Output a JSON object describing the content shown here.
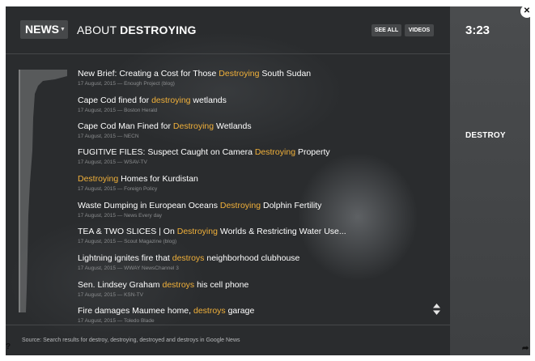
{
  "header": {
    "news_label": "NEWS",
    "title_prefix": "ABOUT",
    "title_term": "DESTROYING",
    "see_all_label": "SEE ALL",
    "videos_label": "VIDEOS"
  },
  "side": {
    "time": "3:23",
    "current_word": "DESTROY"
  },
  "colors": {
    "highlight": "#f0b03a",
    "background": "#2a2c2e"
  },
  "icons": {
    "news_menu": "caret-down-icon",
    "scroll": "up-down-arrows-icon",
    "close": "close-icon",
    "help": "question-icon",
    "share": "share-arrow-icon"
  },
  "items": [
    {
      "before": "New Brief: Creating a Cost for Those ",
      "highlight": "Destroying",
      "after": " South Sudan",
      "meta": "17 August, 2015 — Enough Project (blog)"
    },
    {
      "before": "Cape Cod fined for ",
      "highlight": "destroying",
      "after": " wetlands",
      "meta": "17 August, 2015 — Boston Herald"
    },
    {
      "before": "Cape Cod Man Fined for ",
      "highlight": "Destroying",
      "after": " Wetlands",
      "meta": "17 August, 2015 — NECN"
    },
    {
      "before": "FUGITIVE FILES: Suspect Caught on Camera ",
      "highlight": "Destroying",
      "after": " Property",
      "meta": "17 August, 2015 — WSAV-TV"
    },
    {
      "before": "",
      "highlight": "Destroying",
      "after": " Homes for Kurdistan",
      "meta": "17 August, 2015 — Foreign Policy"
    },
    {
      "before": "Waste Dumping in European Oceans ",
      "highlight": "Destroying",
      "after": " Dolphin Fertility",
      "meta": "17 August, 2015 — News Every day"
    },
    {
      "before": "TEA & TWO SLICES | On ",
      "highlight": "Destroying",
      "after": " Worlds & Restricting Water Use...",
      "meta": "17 August, 2015 — Scout Magazine (blog)"
    },
    {
      "before": "Lightning ignites fire that ",
      "highlight": "destroys",
      "after": " neighborhood clubhouse",
      "meta": "17 August, 2015 — WWAY NewsChannel 3"
    },
    {
      "before": "Sen. Lindsey Graham ",
      "highlight": "destroys",
      "after": " his cell phone",
      "meta": "17 August, 2015 — KSN-TV"
    },
    {
      "before": "Fire damages Maumee home, ",
      "highlight": "destroys",
      "after": " garage",
      "meta": "17 August, 2015 — Toledo Blade"
    }
  ],
  "footer": {
    "source": "Source: Search results for destroy, destroying, destroyed and destroys in Google News"
  }
}
